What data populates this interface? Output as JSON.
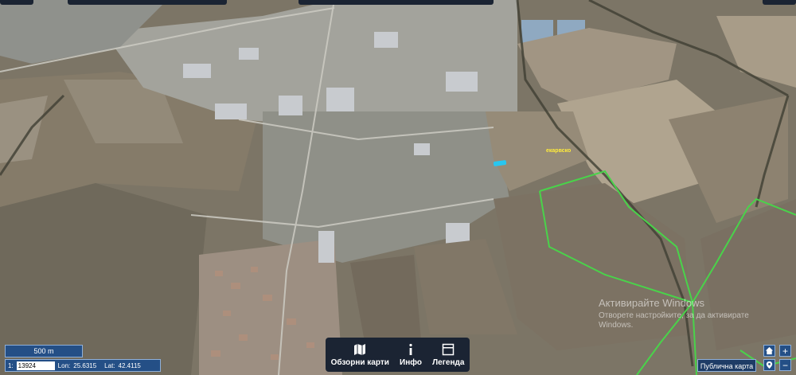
{
  "map": {
    "place_label": "екарвско",
    "colors": {
      "field": "#8e8474",
      "field_dark": "#6b6456",
      "urban": "#a7a8a4",
      "roof": "#c9ccd0",
      "road": "#d0cec6",
      "boundary": "#49d34a",
      "highlight": "#28c6f0"
    }
  },
  "scale": {
    "label": "500 m"
  },
  "coords": {
    "scale_prefix": "1:",
    "scale_value": "13924",
    "lon_label": "Lon:",
    "lon_value": "25.6315",
    "lat_label": "Lat:",
    "lat_value": "42.4115"
  },
  "toolbar": {
    "overview": {
      "label": "Обзорни карти",
      "icon": "map-icon"
    },
    "info": {
      "label": "Инфо",
      "icon": "info-icon"
    },
    "legend": {
      "label": "Легенда",
      "icon": "legend-icon"
    }
  },
  "nav": {
    "home_icon": "home-icon",
    "zoom_in": "+",
    "location_icon": "location-pin-icon",
    "zoom_out": "−"
  },
  "public_map": {
    "label": "Публична карта"
  },
  "watermark": {
    "title": "Активирайте Windows",
    "subtitle": "Отворете настройките, за да активирате Windows."
  }
}
